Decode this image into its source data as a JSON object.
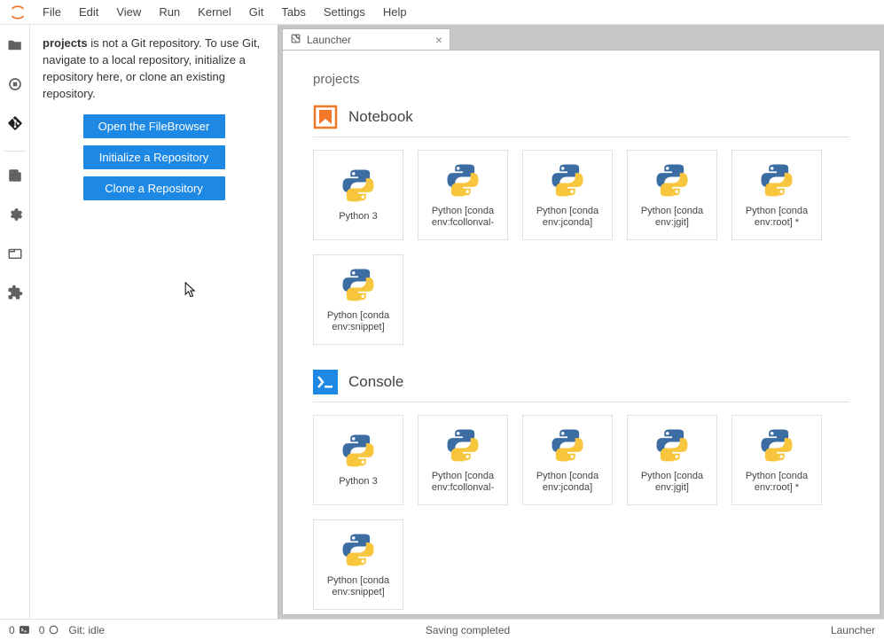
{
  "menubar": {
    "items": [
      "File",
      "Edit",
      "View",
      "Run",
      "Kernel",
      "Git",
      "Tabs",
      "Settings",
      "Help"
    ]
  },
  "leftpanel": {
    "repo_name": "projects",
    "message_rest": " is not a Git repository. To use Git, navigate to a local repository, initialize a repository here, or clone an existing repository.",
    "buttons": {
      "open": "Open the FileBrowser",
      "init": "Initialize a Repository",
      "clone": "Clone a Repository"
    }
  },
  "tab": {
    "label": "Launcher"
  },
  "launcher": {
    "breadcrumb": "projects",
    "sections": [
      {
        "icon": "notebook",
        "title": "Notebook",
        "cards": [
          {
            "label": "Python 3"
          },
          {
            "label": "Python [conda env:fcollonval-"
          },
          {
            "label": "Python [conda env:jconda]"
          },
          {
            "label": "Python [conda env:jgit]"
          },
          {
            "label": "Python [conda env:root] *"
          },
          {
            "label": "Python [conda env:snippet]"
          }
        ]
      },
      {
        "icon": "console",
        "title": "Console",
        "cards": [
          {
            "label": "Python 3"
          },
          {
            "label": "Python [conda env:fcollonval-"
          },
          {
            "label": "Python [conda env:jconda]"
          },
          {
            "label": "Python [conda env:jgit]"
          },
          {
            "label": "Python [conda env:root] *"
          },
          {
            "label": "Python [conda env:snippet]"
          }
        ]
      }
    ]
  },
  "statusbar": {
    "left": {
      "terminals": "0",
      "kernels": "0",
      "git": "Git: idle"
    },
    "center": "Saving completed",
    "right": "Launcher"
  }
}
